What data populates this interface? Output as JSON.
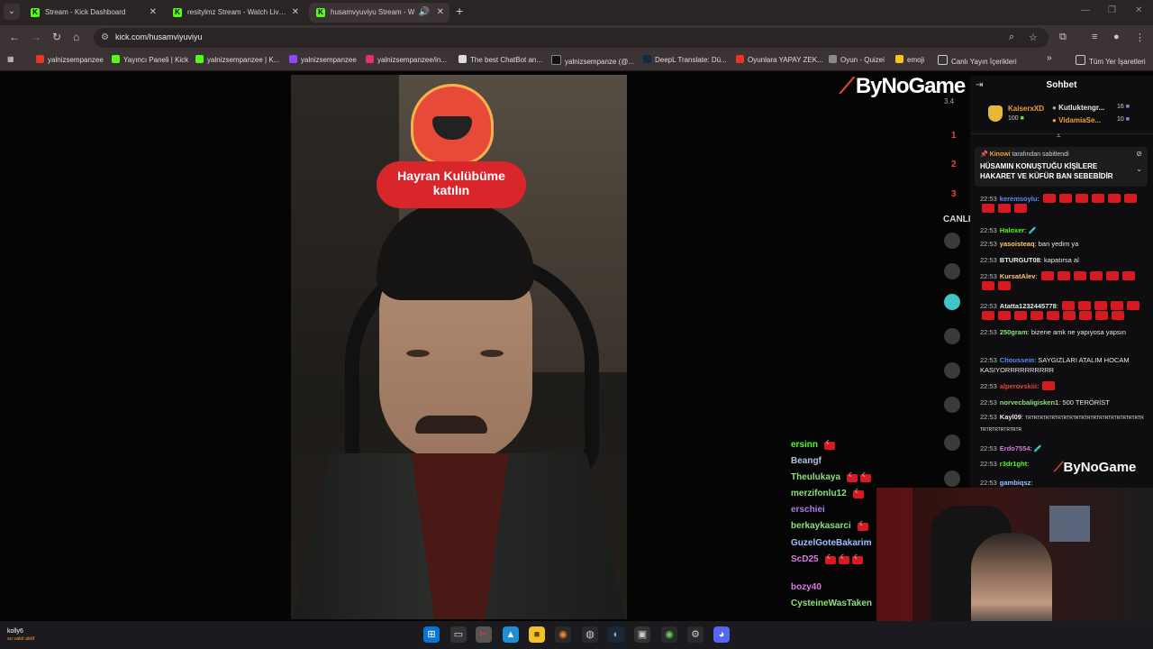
{
  "browser": {
    "tabs": [
      {
        "title": "Stream - Kick Dashboard",
        "active": false
      },
      {
        "title": "resitylmz Stream - Watch Live o",
        "active": false
      },
      {
        "title": "husamvyuviyu Stream - W",
        "active": true
      }
    ],
    "url": "kick.com/husamviyuviyu",
    "bookmarks": [
      "yalnizsempanzee",
      "Yayıncı Paneli | Kick",
      "yalnizsempanzee | K...",
      "yalnizsempanzee",
      "yalnizsempanzee/in...",
      "The best ChatBot an...",
      "yalnizsempanze (@...",
      "DeepL Translate: Dü...",
      "Oyunlara YAPAY ZEK...",
      "Oyun - Quizei",
      "emoji",
      "Canlı Yayın İçerikleri"
    ],
    "bookmarks_more": "»",
    "all_bookmarks": "Tüm Yer İşaretleri"
  },
  "stream": {
    "badge_text_line1": "Hayran Kulübüme",
    "badge_text_line2": "katılın",
    "logo_text": "ByNoGame",
    "side_value": "3.4",
    "ranks": [
      "1",
      "2",
      "3"
    ],
    "canli_label": "CANLI"
  },
  "overlay_chat": [
    {
      "name": "ersinn",
      "color": "#53fc18"
    },
    {
      "name": "Beangf",
      "color": "#b0c4de"
    },
    {
      "name": "Theulukaya",
      "color": "#8ee07a"
    },
    {
      "name": "merzifonlu12",
      "color": "#8ee07a"
    },
    {
      "name": "erschiei",
      "color": "#b07ae0"
    },
    {
      "name": "berkaykasarci",
      "color": "#8ee07a"
    },
    {
      "name": "GuzelGoteBakarim",
      "color": "#9bc1ff"
    },
    {
      "name": "ScD25",
      "color": "#d97ae0"
    },
    {
      "name": "bozy40",
      "color": "#d97ae0"
    },
    {
      "name": "CysteineWasTaken",
      "color": "#8ee07a"
    }
  ],
  "chat": {
    "title": "Sohbet",
    "gifters": [
      {
        "name": "KaiserxXD",
        "amount": "100"
      },
      {
        "name": "Kutluktengr...",
        "amount": "16"
      },
      {
        "name": "VidamiaSe...",
        "amount": "10"
      }
    ],
    "pinned_by_user": "Kinowi",
    "pinned_by_suffix": "tarafından sabitlendi",
    "pinned_message": "HÜSAMIN KONUŞTUĞU KİŞİLERE HAKARET VE KÜFÜR BAN SEBEBİDİR",
    "messages": [
      {
        "time": "22:53",
        "user": "keremsoylu",
        "color": "#5b8cff",
        "text": ""
      },
      {
        "time": "22:53",
        "user": "Haloxer",
        "color": "#53fc18",
        "text": ""
      },
      {
        "time": "22:53",
        "user": "yasoisteaq",
        "color": "#ffcc66",
        "text": "ban yedim ya"
      },
      {
        "time": "22:53",
        "user": "BTURGUT08",
        "color": "#e9e9e9",
        "text": "kapatırsa al"
      },
      {
        "time": "22:53",
        "user": "KursatAlev",
        "color": "#ffcc66",
        "text": ""
      },
      {
        "time": "22:53",
        "user": "Atatta1232445778",
        "color": "#e9e9e9",
        "text": ""
      },
      {
        "time": "22:53",
        "user": "250gram",
        "color": "#8ee07a",
        "text": "bizene amk ne yapıyosa yapsın"
      },
      {
        "time": "22:53",
        "user": "Chousseın",
        "color": "#5b8cff",
        "text": "SAYGIZLARI ATALIM HOCAM KASIYORRRRRRRRRR"
      },
      {
        "time": "22:53",
        "user": "alperovskiii",
        "color": "#e3443a",
        "text": ""
      },
      {
        "time": "22:53",
        "user": "norvecbaligisken1",
        "color": "#8ee07a",
        "text": "500 TERÖRİST"
      },
      {
        "time": "22:53",
        "user": "Kayl09",
        "color": "#e9e9e9",
        "text": "TRTRTRTRTRTRTRTRTRTRTRTRTRTRTRTRTRTRTRTRTRTRTRTRTRTRTR"
      },
      {
        "time": "22:53",
        "user": "Erdo7554",
        "color": "#d97ae0",
        "text": ""
      },
      {
        "time": "22:53",
        "user": "r3dr1ght",
        "color": "#53fc18",
        "text": ""
      },
      {
        "time": "22:53",
        "user": "gambiqsz",
        "color": "#9bc1ff",
        "text": ""
      }
    ]
  },
  "cam_logo_text": "ByNoGame",
  "taskbar": {
    "weather_label": "kolly6",
    "weather_sub": "su vakti aktif"
  },
  "colors": {
    "kick_green": "#53fc18",
    "brand_red": "#e3443a"
  }
}
